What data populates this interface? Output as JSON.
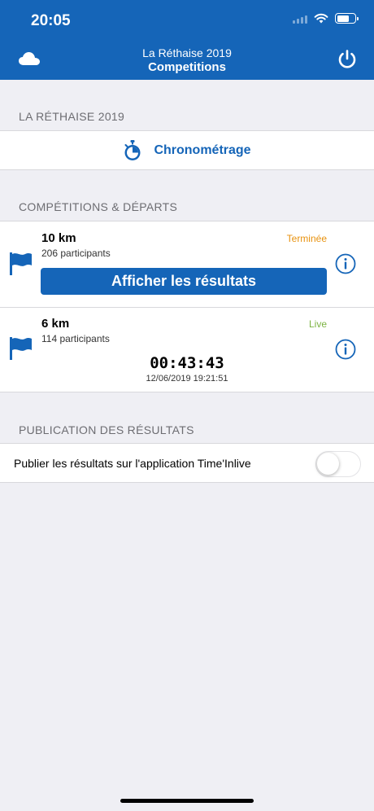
{
  "status_bar": {
    "time": "20:05"
  },
  "nav": {
    "subtitle": "La Réthaise 2019",
    "title": "Competitions"
  },
  "event_section": {
    "header": "LA RÉTHAISE 2019",
    "chrono_label": "Chronométrage"
  },
  "competitions_section": {
    "header": "COMPÉTITIONS & DÉPARTS",
    "races": [
      {
        "name": "10 km",
        "participants": "206 participants",
        "status": "Terminée",
        "button": "Afficher les résultats"
      },
      {
        "name": "6 km",
        "participants": "114 participants",
        "status": "Live",
        "timer": "00:43:43",
        "timestamp": "12/06/2019 19:21:51"
      }
    ]
  },
  "publication_section": {
    "header": "PUBLICATION DES RÉSULTATS",
    "publish_label": "Publier les résultats sur l'application Time'Inlive",
    "publish_enabled": false
  },
  "colors": {
    "brand": "#1565b8",
    "done": "#e8920f",
    "live": "#7cb342"
  },
  "icons": [
    "cloud-icon",
    "power-icon",
    "stopwatch-icon",
    "flag-icon",
    "info-icon"
  ]
}
